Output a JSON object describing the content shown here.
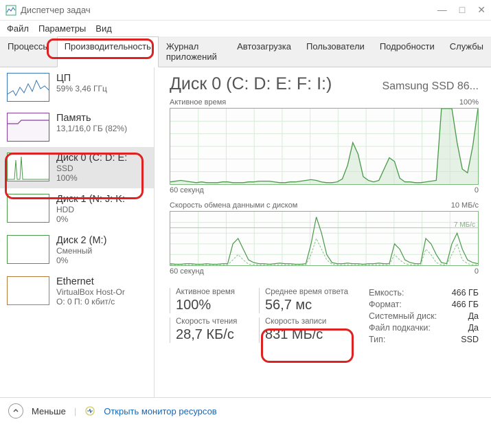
{
  "window": {
    "title": "Диспетчер задач"
  },
  "menu": {
    "file": "Файл",
    "options": "Параметры",
    "view": "Вид"
  },
  "tabs": {
    "processes": "Процессы",
    "performance": "Производительность",
    "app_history": "Журнал приложений",
    "startup": "Автозагрузка",
    "users": "Пользователи",
    "details": "Подробности",
    "services": "Службы"
  },
  "sidebar": {
    "cpu": {
      "title": "ЦП",
      "sub": "59%  3,46 ГГц"
    },
    "memory": {
      "title": "Память",
      "sub": "13,1/16,0 ГБ (82%)"
    },
    "disk0": {
      "title": "Диск 0 (C: D: E:",
      "sub1": "SSD",
      "sub2": "100%"
    },
    "disk1": {
      "title": "Диск 1 (N: J: K:",
      "sub1": "HDD",
      "sub2": "0%"
    },
    "disk2": {
      "title": "Диск 2 (M:)",
      "sub1": "Сменный",
      "sub2": "0%"
    },
    "eth": {
      "title": "Ethernet",
      "sub1": "VirtualBox Host-Or",
      "sub2": "О: 0  П: 0 кбит/с"
    }
  },
  "main": {
    "title": "Диск 0 (C: D: E: F: I:)",
    "model": "Samsung SSD 86...",
    "chart1": {
      "label": "Активное время",
      "max": "100%",
      "xaxis": "60 секунд",
      "xmax": "0"
    },
    "chart2": {
      "label": "Скорость обмена данными с диском",
      "max": "10 МБ/с",
      "inner": "7 МБ/с",
      "xaxis": "60 секунд",
      "xmax": "0"
    },
    "stats": {
      "active_time": {
        "label": "Активное время",
        "value": "100%"
      },
      "avg_response": {
        "label": "Среднее время ответа",
        "value": "56,7 мс"
      },
      "read_speed": {
        "label": "Скорость чтения",
        "value": "28,7 КБ/с"
      },
      "write_speed": {
        "label": "Скорость записи",
        "value": "831 МБ/с"
      }
    },
    "props": {
      "capacity": {
        "k": "Емкость:",
        "v": "466 ГБ"
      },
      "formatted": {
        "k": "Формат:",
        "v": "466 ГБ"
      },
      "system_disk": {
        "k": "Системный диск:",
        "v": "Да"
      },
      "pagefile": {
        "k": "Файл подкачки:",
        "v": "Да"
      },
      "type": {
        "k": "Тип:",
        "v": "SSD"
      }
    }
  },
  "footer": {
    "less": "Меньше",
    "resmon": "Открыть монитор ресурсов"
  },
  "chart_data": [
    {
      "type": "area",
      "title": "Активное время",
      "ylabel": "%",
      "ylim": [
        0,
        100
      ],
      "x_seconds": 60,
      "values": [
        3,
        4,
        5,
        4,
        3,
        2,
        3,
        2,
        2,
        2,
        3,
        3,
        2,
        2,
        2,
        3,
        3,
        4,
        4,
        4,
        3,
        2,
        2,
        3,
        3,
        4,
        5,
        6,
        5,
        3,
        2,
        2,
        3,
        7,
        25,
        55,
        40,
        10,
        5,
        3,
        5,
        20,
        35,
        30,
        8,
        3,
        3,
        2,
        2,
        3,
        4,
        5,
        100,
        100,
        100,
        55,
        20,
        15,
        50,
        100
      ]
    },
    {
      "type": "line",
      "title": "Скорость обмена данными с диском",
      "ylabel": "МБ/с",
      "ylim": [
        0,
        10
      ],
      "guideline": 7,
      "x_seconds": 60,
      "series": [
        {
          "name": "read",
          "values": [
            0.3,
            0.2,
            0.2,
            0.3,
            0.3,
            0.2,
            0.2,
            0.3,
            0.2,
            0.2,
            0.3,
            0.3,
            4,
            5,
            3,
            1,
            0.5,
            0.3,
            0.3,
            0.2,
            0.3,
            0.4,
            0.3,
            0.3,
            0.2,
            0.2,
            0.3,
            4,
            9,
            6,
            2,
            0.5,
            0.3,
            0.3,
            0.4,
            0.3,
            0.3,
            0.2,
            0.3,
            0.3,
            0.4,
            0.3,
            0.3,
            4,
            3,
            1,
            0.5,
            0.3,
            0.3,
            5,
            4,
            2,
            0.5,
            0.3,
            4,
            6,
            3,
            1,
            0.5,
            0.3
          ]
        },
        {
          "name": "write",
          "values": [
            0.1,
            0.1,
            0.1,
            0.1,
            0.1,
            0.1,
            0.1,
            0.1,
            0.1,
            0.1,
            0.1,
            0.1,
            1,
            2,
            1,
            0.2,
            0.1,
            0.1,
            0.1,
            0.1,
            0.1,
            0.1,
            0.1,
            0.1,
            0.1,
            0.1,
            0.1,
            2,
            5,
            3,
            1,
            0.2,
            0.1,
            0.1,
            0.1,
            0.1,
            0.1,
            0.1,
            0.1,
            0.1,
            0.1,
            0.1,
            0.1,
            2,
            1,
            0.3,
            0.1,
            0.1,
            0.1,
            3,
            2,
            0.5,
            0.1,
            0.1,
            2,
            4,
            1,
            0.3,
            0.1,
            0.1
          ]
        }
      ]
    }
  ]
}
